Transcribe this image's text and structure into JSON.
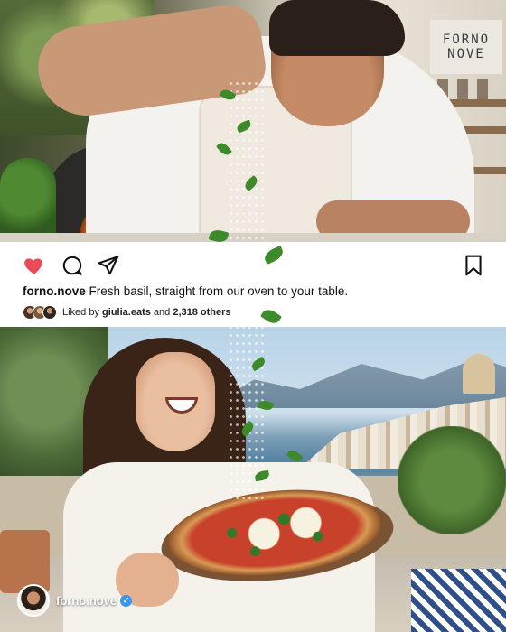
{
  "post": {
    "username": "forno.nove",
    "caption": "Fresh basil, straight from our oven to your table.",
    "likes": {
      "prefix": "Liked by",
      "first_liker": "giulia.eats",
      "conjunction": "and",
      "others": "2,318 others"
    },
    "liked": true
  },
  "actions": {
    "like_icon": "heart-filled-icon",
    "comment_icon": "comment-icon",
    "share_icon": "paper-plane-icon",
    "save_icon": "bookmark-icon"
  },
  "photo_top": {
    "sign_line1": "FORNO",
    "sign_line2": "NOVE"
  },
  "profile": {
    "name": "forno.nove",
    "verified_icon": "verified-badge-icon"
  },
  "colors": {
    "like": "#ed4956",
    "verified": "#3897f0",
    "icon_stroke": "#111111"
  }
}
